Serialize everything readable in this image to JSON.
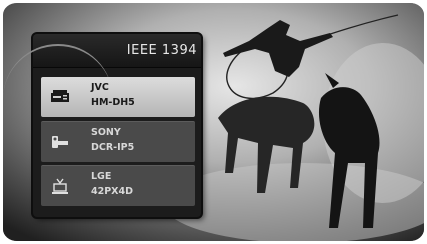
{
  "panel": {
    "title": "IEEE 1394"
  },
  "devices": [
    {
      "brand": "JVC",
      "model": "HM-DH5",
      "icon": "vcr-icon",
      "selected": true
    },
    {
      "brand": "SONY",
      "model": "DCR-IP5",
      "icon": "camcorder-icon",
      "selected": false
    },
    {
      "brand": "LGE",
      "model": "42PX4D",
      "icon": "tv-set-icon",
      "selected": false
    }
  ],
  "colors": {
    "panel_bg": "#1c1c1c",
    "selected_bg": "#cfcfcf",
    "item_bg": "#4a4a4a"
  }
}
